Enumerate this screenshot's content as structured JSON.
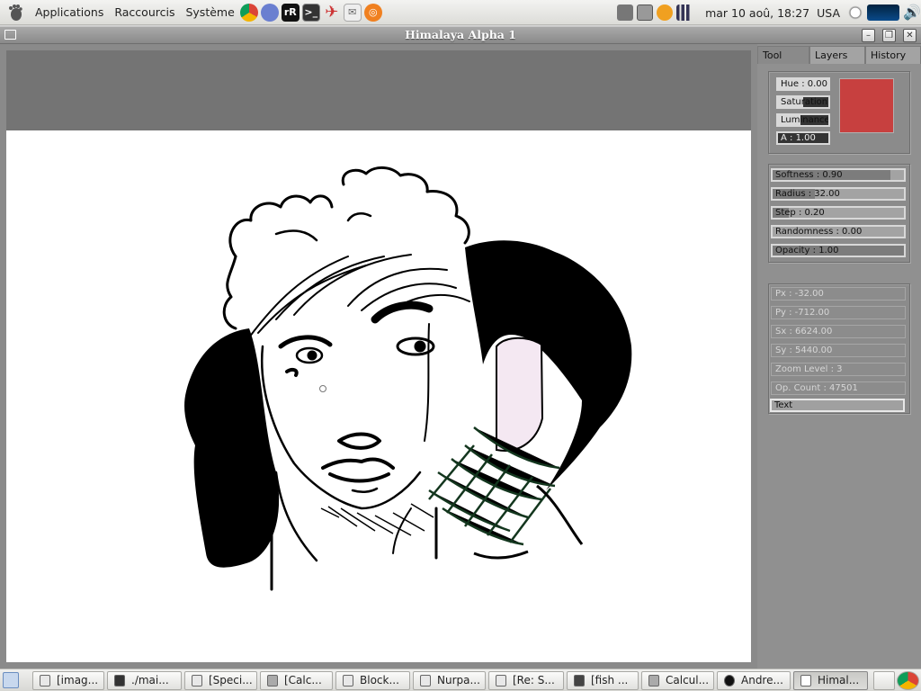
{
  "panel": {
    "menus": [
      "Applications",
      "Raccourcis",
      "Système"
    ],
    "clock": "mar 10 aoû, 18:27",
    "keyboard": "USA"
  },
  "window": {
    "title": "Himalaya Alpha 1"
  },
  "sidepanel": {
    "tabs": [
      "Tool",
      "Layers",
      "History"
    ],
    "active_tab": "Tool",
    "color": {
      "hue": "Hue : 0.00",
      "saturation": "Saturation",
      "luminance": "Luminance",
      "alpha": "A : 1.00",
      "saturation_level": 0.5,
      "luminance_level": 0.45,
      "swatch": "#c7403f"
    },
    "brush": {
      "softness": {
        "label": "Softness : 0.90",
        "value": 0.9
      },
      "radius": {
        "label": "Radius : 32.00",
        "value": 0.32
      },
      "step": {
        "label": "Step : 0.20",
        "value": 0.12
      },
      "randomness": {
        "label": "Randomness : 0.00",
        "value": 0.0
      },
      "opacity": {
        "label": "Opacity : 1.00",
        "value": 1.0
      }
    },
    "info": {
      "px": "Px : -32.00",
      "py": "Py : -712.00",
      "sx": "Sx : 6624.00",
      "sy": "Sy : 5440.00",
      "zoom": "Zoom Level : 3",
      "op_count": "Op. Count : 47501"
    },
    "text_field": "Text"
  },
  "taskbar": {
    "tasks": [
      "[imag...",
      "./mai...",
      "[Speci...",
      "[Calc...",
      "Block...",
      "Nurpa...",
      "[Re: S...",
      "[fish ...",
      "Calcul...",
      "Andre...",
      "Himal..."
    ],
    "active_task": "Himal..."
  },
  "colors": {
    "ink": "#000000",
    "highlight": "#f4e8f2",
    "hatch_green": "#13361e",
    "swatch": "#c7403f"
  }
}
